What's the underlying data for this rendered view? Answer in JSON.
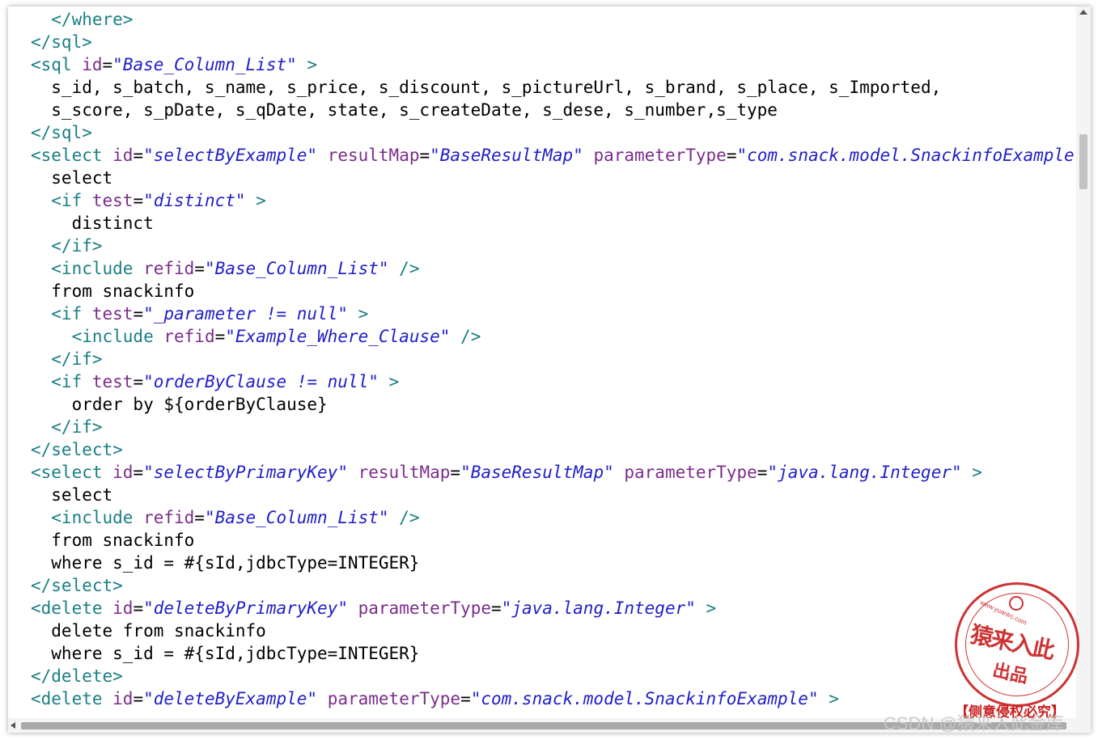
{
  "editor": {
    "lines": [
      [
        {
          "t": "tag",
          "v": "  </where>"
        }
      ],
      [
        {
          "t": "tag",
          "v": "</sql>"
        }
      ],
      [
        {
          "t": "tag",
          "v": "<sql "
        },
        {
          "t": "attr",
          "v": "id"
        },
        {
          "t": "eq",
          "v": "="
        },
        {
          "t": "val",
          "v": "\"Base_Column_List\""
        },
        {
          "t": "tag",
          "v": " >"
        }
      ],
      [
        {
          "t": "txt",
          "v": "  s_id, s_batch, s_name, s_price, s_discount, s_pictureUrl, s_brand, s_place, s_Imported,"
        }
      ],
      [
        {
          "t": "txt",
          "v": "  s_score, s_pDate, s_qDate, state, s_createDate, s_dese, s_number,s_type"
        }
      ],
      [
        {
          "t": "tag",
          "v": "</sql>"
        }
      ],
      [
        {
          "t": "tag",
          "v": "<select "
        },
        {
          "t": "attr",
          "v": "id"
        },
        {
          "t": "eq",
          "v": "="
        },
        {
          "t": "val",
          "v": "\"selectByExample\""
        },
        {
          "t": "attr",
          "v": " resultMap"
        },
        {
          "t": "eq",
          "v": "="
        },
        {
          "t": "val",
          "v": "\"BaseResultMap\""
        },
        {
          "t": "attr",
          "v": " parameterType"
        },
        {
          "t": "eq",
          "v": "="
        },
        {
          "t": "val",
          "v": "\"com.snack.model.SnackinfoExample\""
        },
        {
          "t": "tag",
          "v": " >"
        }
      ],
      [
        {
          "t": "txt",
          "v": "  select"
        }
      ],
      [
        {
          "t": "tag",
          "v": "  <if "
        },
        {
          "t": "attr",
          "v": "test"
        },
        {
          "t": "eq",
          "v": "="
        },
        {
          "t": "val",
          "v": "\"distinct\""
        },
        {
          "t": "tag",
          "v": " >"
        }
      ],
      [
        {
          "t": "txt",
          "v": "    distinct"
        }
      ],
      [
        {
          "t": "tag",
          "v": "  </if>"
        }
      ],
      [
        {
          "t": "tag",
          "v": "  <include "
        },
        {
          "t": "attr",
          "v": "refid"
        },
        {
          "t": "eq",
          "v": "="
        },
        {
          "t": "val",
          "v": "\"Base_Column_List\""
        },
        {
          "t": "tag",
          "v": " />"
        }
      ],
      [
        {
          "t": "txt",
          "v": "  from snackinfo"
        }
      ],
      [
        {
          "t": "tag",
          "v": "  <if "
        },
        {
          "t": "attr",
          "v": "test"
        },
        {
          "t": "eq",
          "v": "="
        },
        {
          "t": "val",
          "v": "\"_parameter != null\""
        },
        {
          "t": "tag",
          "v": " >"
        }
      ],
      [
        {
          "t": "tag",
          "v": "    <include "
        },
        {
          "t": "attr",
          "v": "refid"
        },
        {
          "t": "eq",
          "v": "="
        },
        {
          "t": "val",
          "v": "\"Example_Where_Clause\""
        },
        {
          "t": "tag",
          "v": " />"
        }
      ],
      [
        {
          "t": "tag",
          "v": "  </if>"
        }
      ],
      [
        {
          "t": "tag",
          "v": "  <if "
        },
        {
          "t": "attr",
          "v": "test"
        },
        {
          "t": "eq",
          "v": "="
        },
        {
          "t": "val",
          "v": "\"orderByClause != null\""
        },
        {
          "t": "tag",
          "v": " >"
        }
      ],
      [
        {
          "t": "txt",
          "v": "    order by ${orderByClause}"
        }
      ],
      [
        {
          "t": "tag",
          "v": "  </if>"
        }
      ],
      [
        {
          "t": "tag",
          "v": "</select>"
        }
      ],
      [
        {
          "t": "tag",
          "v": "<select "
        },
        {
          "t": "attr",
          "v": "id"
        },
        {
          "t": "eq",
          "v": "="
        },
        {
          "t": "val",
          "v": "\"selectByPrimaryKey\""
        },
        {
          "t": "attr",
          "v": " resultMap"
        },
        {
          "t": "eq",
          "v": "="
        },
        {
          "t": "val",
          "v": "\"BaseResultMap\""
        },
        {
          "t": "attr",
          "v": " parameterType"
        },
        {
          "t": "eq",
          "v": "="
        },
        {
          "t": "val",
          "v": "\"java.lang.Integer\""
        },
        {
          "t": "tag",
          "v": " >"
        }
      ],
      [
        {
          "t": "txt",
          "v": "  select"
        }
      ],
      [
        {
          "t": "tag",
          "v": "  <include "
        },
        {
          "t": "attr",
          "v": "refid"
        },
        {
          "t": "eq",
          "v": "="
        },
        {
          "t": "val",
          "v": "\"Base_Column_List\""
        },
        {
          "t": "tag",
          "v": " />"
        }
      ],
      [
        {
          "t": "txt",
          "v": "  from snackinfo"
        }
      ],
      [
        {
          "t": "txt",
          "v": "  where s_id = #{sId,jdbcType=INTEGER}"
        }
      ],
      [
        {
          "t": "tag",
          "v": "</select>"
        }
      ],
      [
        {
          "t": "tag",
          "v": "<delete "
        },
        {
          "t": "attr",
          "v": "id"
        },
        {
          "t": "eq",
          "v": "="
        },
        {
          "t": "val",
          "v": "\"deleteByPrimaryKey\""
        },
        {
          "t": "attr",
          "v": " parameterType"
        },
        {
          "t": "eq",
          "v": "="
        },
        {
          "t": "val",
          "v": "\"java.lang.Integer\""
        },
        {
          "t": "tag",
          "v": " >"
        }
      ],
      [
        {
          "t": "txt",
          "v": "  delete from snackinfo"
        }
      ],
      [
        {
          "t": "txt",
          "v": "  where s_id = #{sId,jdbcType=INTEGER}"
        }
      ],
      [
        {
          "t": "tag",
          "v": "</delete>"
        }
      ],
      [
        {
          "t": "tag",
          "v": "<delete "
        },
        {
          "t": "attr",
          "v": "id"
        },
        {
          "t": "eq",
          "v": "="
        },
        {
          "t": "val",
          "v": "\"deleteByExample\""
        },
        {
          "t": "attr",
          "v": " parameterType"
        },
        {
          "t": "eq",
          "v": "="
        },
        {
          "t": "val",
          "v": "\"com.snack.model.SnackinfoExample\""
        },
        {
          "t": "tag",
          "v": " >"
        }
      ]
    ]
  },
  "watermark": {
    "stamp_url": "www.yuanlrc.com",
    "stamp_main": "猿来入此",
    "stamp_sub": "出品",
    "stamp_footer": "【侧意侵权必究】",
    "csdn_credit": "CSDN @猿来入此金库"
  }
}
